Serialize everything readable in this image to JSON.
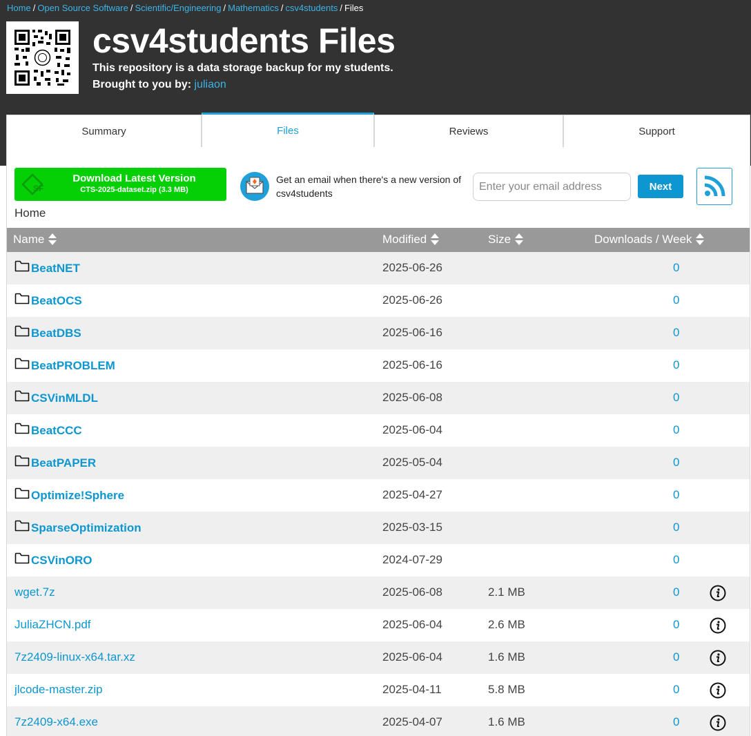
{
  "breadcrumb": {
    "items": [
      "Home",
      "Open Source Software",
      "Scientific/Engineering",
      "Mathematics",
      "csv4students"
    ],
    "current": "Files"
  },
  "project": {
    "title": "csv4students Files",
    "description": "This repository is a data storage backup for my students.",
    "brought_by_label": "Brought to you by:",
    "author": "juliaon"
  },
  "tabs": [
    {
      "label": "Summary",
      "active": false
    },
    {
      "label": "Files",
      "active": true
    },
    {
      "label": "Reviews",
      "active": false
    },
    {
      "label": "Support",
      "active": false
    }
  ],
  "download": {
    "label": "Download Latest Version",
    "file": "CTS-2025-dataset.zip (3.3 MB)"
  },
  "notify": {
    "text": "Get an email when there's a new version of csv4students",
    "placeholder": "Enter your email address",
    "button": "Next"
  },
  "path": "Home",
  "table": {
    "headers": {
      "name": "Name",
      "modified": "Modified",
      "size": "Size",
      "downloads": "Downloads / Week"
    },
    "rows": [
      {
        "type": "folder",
        "name": "BeatNET",
        "modified": "2025-06-26",
        "size": "",
        "downloads": "0"
      },
      {
        "type": "folder",
        "name": "BeatOCS",
        "modified": "2025-06-26",
        "size": "",
        "downloads": "0"
      },
      {
        "type": "folder",
        "name": "BeatDBS",
        "modified": "2025-06-16",
        "size": "",
        "downloads": "0"
      },
      {
        "type": "folder",
        "name": "BeatPROBLEM",
        "modified": "2025-06-16",
        "size": "",
        "downloads": "0"
      },
      {
        "type": "folder",
        "name": "CSVinMLDL",
        "modified": "2025-06-08",
        "size": "",
        "downloads": "0"
      },
      {
        "type": "folder",
        "name": "BeatCCC",
        "modified": "2025-06-04",
        "size": "",
        "downloads": "0"
      },
      {
        "type": "folder",
        "name": "BeatPAPER",
        "modified": "2025-05-04",
        "size": "",
        "downloads": "0"
      },
      {
        "type": "folder",
        "name": "Optimize!Sphere",
        "modified": "2025-04-27",
        "size": "",
        "downloads": "0"
      },
      {
        "type": "folder",
        "name": "SparseOptimization",
        "modified": "2025-03-15",
        "size": "",
        "downloads": "0"
      },
      {
        "type": "folder",
        "name": "CSVinORO",
        "modified": "2024-07-29",
        "size": "",
        "downloads": "0"
      },
      {
        "type": "file",
        "name": "wget.7z",
        "modified": "2025-06-08",
        "size": "2.1 MB",
        "downloads": "0"
      },
      {
        "type": "file",
        "name": "JuliaZHCN.pdf",
        "modified": "2025-06-04",
        "size": "2.6 MB",
        "downloads": "0"
      },
      {
        "type": "file",
        "name": "7z2409-linux-x64.tar.xz",
        "modified": "2025-06-04",
        "size": "1.6 MB",
        "downloads": "0"
      },
      {
        "type": "file",
        "name": "jlcode-master.zip",
        "modified": "2025-04-11",
        "size": "5.8 MB",
        "downloads": "0"
      },
      {
        "type": "file",
        "name": "7z2409-x64.exe",
        "modified": "2025-04-07",
        "size": "1.6 MB",
        "downloads": "0"
      }
    ]
  },
  "colors": {
    "header_bg": "#323232",
    "accent": "#1fa0d8",
    "download_green": "#05cf05",
    "table_header": "#999999"
  },
  "icons": {
    "folder": "folder-icon",
    "info": "info-icon",
    "rss": "rss-icon",
    "mail": "mail-icon",
    "qr": "qr-code"
  }
}
